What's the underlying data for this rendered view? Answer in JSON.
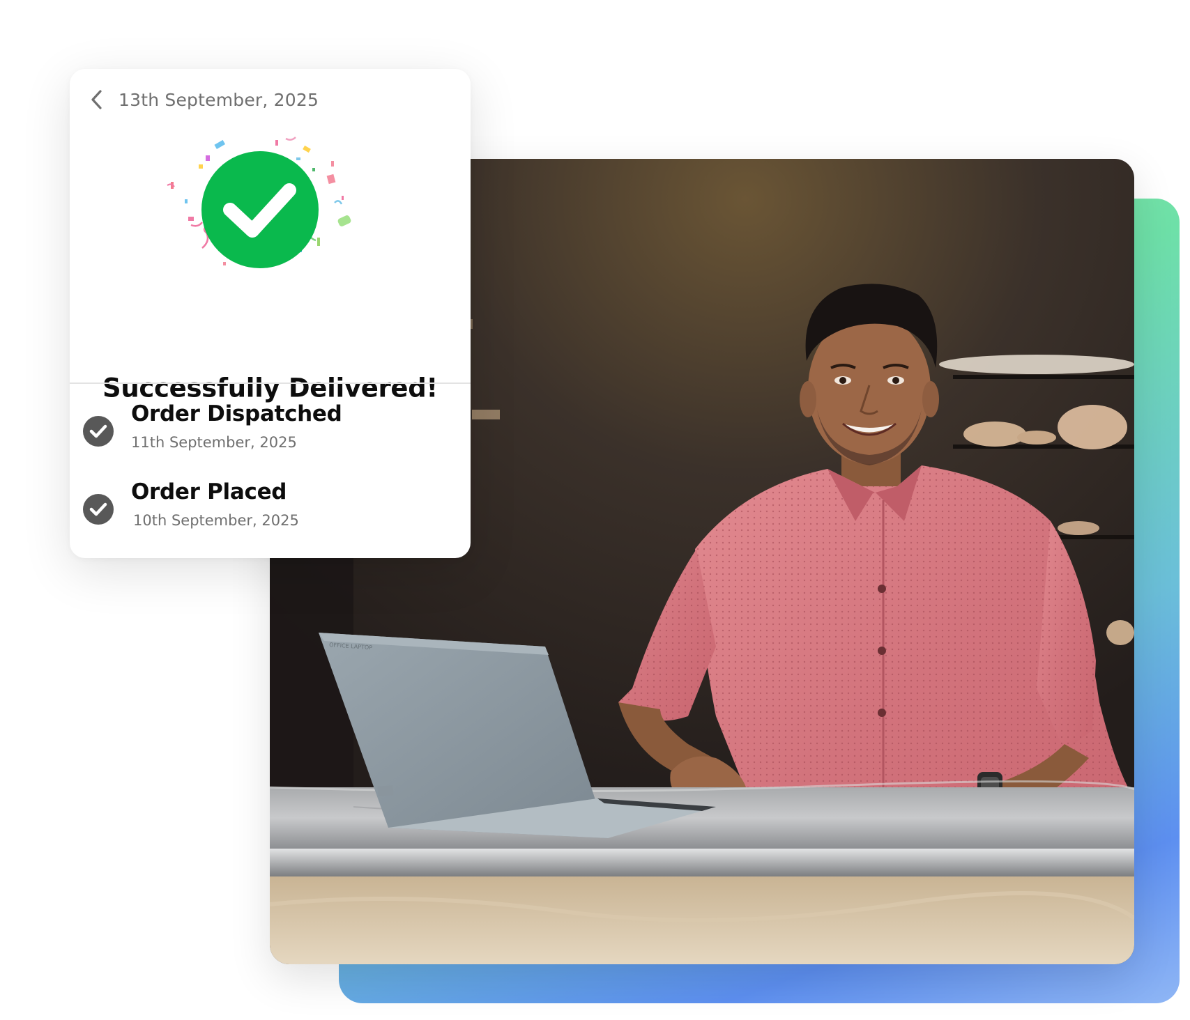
{
  "header": {
    "date": "13th September, 2025",
    "back_icon": "chevron-left-icon"
  },
  "status": {
    "title": "Successfully Delivered!",
    "badge_icon": "check-circle-icon",
    "badge_color": "#0ab94d"
  },
  "timeline": [
    {
      "title": "Order Dispatched",
      "date": "11th September, 2025",
      "icon": "check-circle-icon"
    },
    {
      "title": "Order Placed",
      "date": "10th September, 2025",
      "icon": "check-circle-icon"
    }
  ],
  "colors": {
    "success_green": "#0ab94d",
    "step_icon": "#585858",
    "gradient": [
      "#8ff0a4",
      "#6bbfd9",
      "#5d8ff0"
    ]
  }
}
